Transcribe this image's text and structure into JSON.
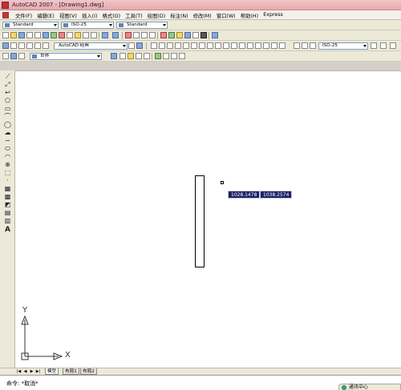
{
  "window": {
    "title": "AutoCAD 2007 - [Drawing1.dwg]"
  },
  "menu": {
    "items": [
      "文件(F)",
      "编辑(E)",
      "视图(V)",
      "插入(I)",
      "格式(O)",
      "工具(T)",
      "绘图(D)",
      "标注(N)",
      "修改(M)",
      "窗口(W)",
      "帮助(H)",
      "Express"
    ]
  },
  "styles_toolbar": {
    "text_style": "Standard",
    "dim_style": "ISO-25",
    "table_style": "Standard"
  },
  "workspace_toolbar": {
    "workspace": "AutoCAD 经典",
    "dim_style": "ISO-25"
  },
  "layers_toolbar": {
    "layer": "世界"
  },
  "canvas": {
    "coord_x": "1028.1478",
    "coord_y": "1038.2574",
    "ucs_x_label": "X",
    "ucs_y_label": "Y"
  },
  "tabs": {
    "model": "模型",
    "layout1": "布局1",
    "layout2": "布局2"
  },
  "nav": {
    "first": "|◀",
    "prev": "◀",
    "next": "▶",
    "last": "▶|"
  },
  "command": {
    "text": "命令: *取消*"
  },
  "comm_center": {
    "label": "通讯中心"
  },
  "colors": {
    "coord_bg": "#1b2266",
    "title_bg": "#e6a9ad",
    "canvas_bg": "#ffffff"
  }
}
